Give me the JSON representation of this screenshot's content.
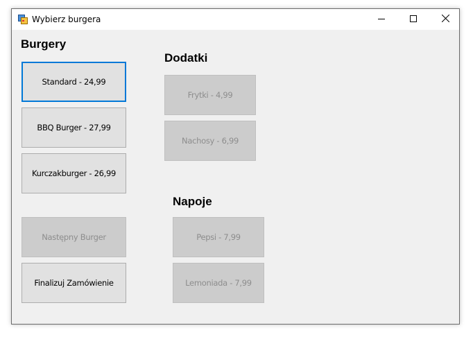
{
  "window": {
    "title": "Wybierz burgera",
    "icons": {
      "app": "form-icon",
      "minimize": "minimize-icon",
      "maximize": "maximize-icon",
      "close": "close-icon"
    }
  },
  "burgers": {
    "heading": "Burgery",
    "items": [
      {
        "label": "Standard - 24,99"
      },
      {
        "label": "BBQ Burger - 27,99"
      },
      {
        "label": "Kurczakburger - 26,99"
      }
    ],
    "next_label": "Następny Burger",
    "finalize_label": "Finalizuj Zamówienie"
  },
  "extras": {
    "heading": "Dodatki",
    "items": [
      {
        "label": "Frytki - 4,99"
      },
      {
        "label": "Nachosy - 6,99"
      }
    ]
  },
  "drinks": {
    "heading": "Napoje",
    "items": [
      {
        "label": "Pepsi - 7,99"
      },
      {
        "label": "Lemoniada - 7,99"
      }
    ]
  },
  "colors": {
    "focus_border": "#0078d7",
    "button_face": "#e1e1e1",
    "disabled_face": "#cccccc",
    "disabled_text": "#8d8d8d",
    "window_bg": "#f0f0f0"
  }
}
